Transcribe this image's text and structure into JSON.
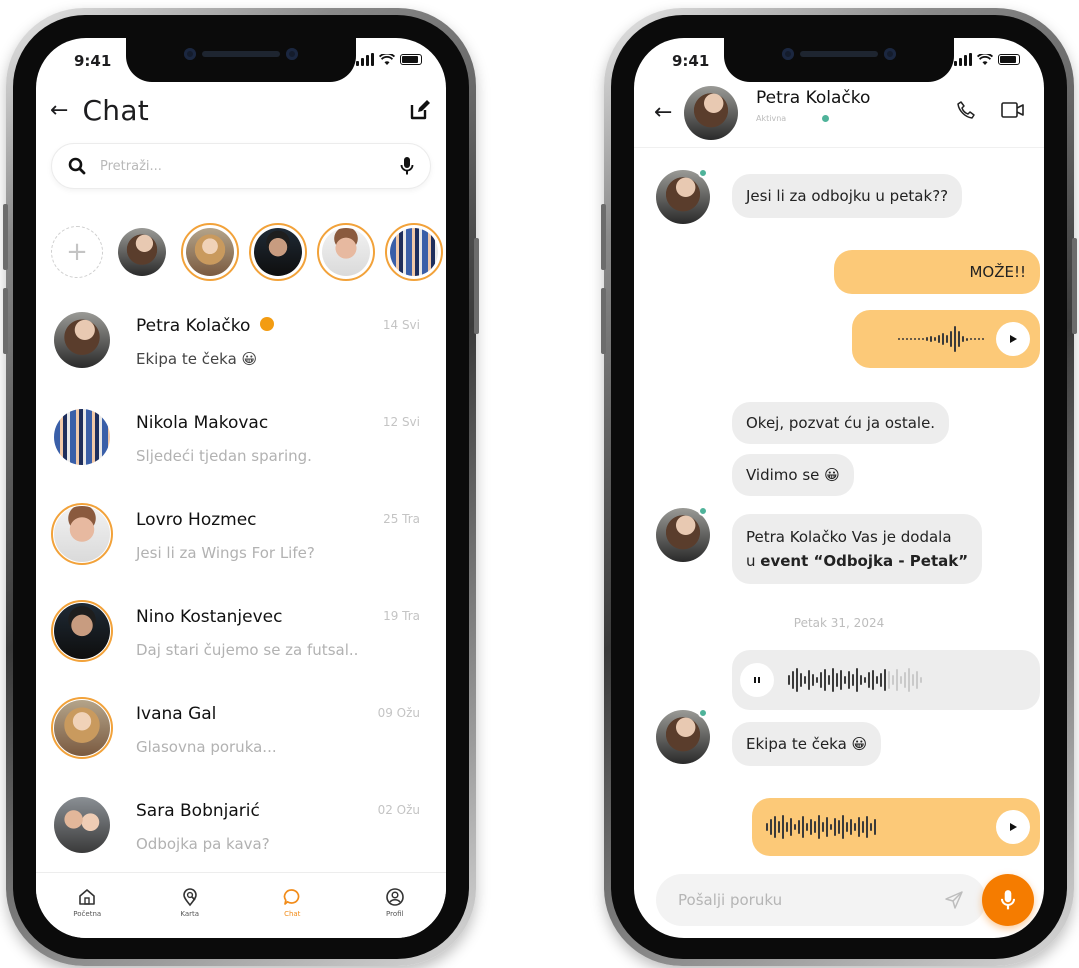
{
  "status_time": "9:41",
  "chat_screen": {
    "title": "Chat",
    "search_placeholder": "Pretraži...",
    "conversations": [
      {
        "name": "Petra Kolačko",
        "message": "Ekipa te čeka 😀",
        "date": "14 Svi",
        "unread": true
      },
      {
        "name": "Nikola Makovac",
        "message": "Sljedeći tjedan sparing.",
        "date": "12 Svi",
        "unread": false
      },
      {
        "name": "Lovro Hozmec",
        "message": "Jesi li za Wings For Life?",
        "date": "25 Tra",
        "unread": false
      },
      {
        "name": "Nino Kostanjevec",
        "message": "Daj stari čujemo se za futsal..",
        "date": "19 Tra",
        "unread": false
      },
      {
        "name": "Ivana Gal",
        "message": "Glasovna poruka...",
        "date": "09 Ožu",
        "unread": false
      },
      {
        "name": "Sara Bobnjarić",
        "message": "Odbojka pa kava?",
        "date": "02 Ožu",
        "unread": false
      }
    ],
    "tabs": [
      {
        "label": "Početna",
        "icon": "home-icon"
      },
      {
        "label": "Karta",
        "icon": "map-search-icon"
      },
      {
        "label": "Chat",
        "icon": "chat-bubble-icon",
        "active": true
      },
      {
        "label": "Profil",
        "icon": "profile-icon"
      }
    ]
  },
  "conversation_screen": {
    "contact_name": "Petra Kolačko",
    "contact_status": "Aktivna",
    "messages": {
      "m1": "Jesi li za odbojku u petak??",
      "m2": "MOŽE!!",
      "m4": "Okej, pozvat ću ja ostale.",
      "m5": "Vidimo se 😀",
      "m6_line1": "Petra Kolačko Vas je dodala",
      "m6_line2_prefix": "u ",
      "m6_line2_bold": "event “Odbojka - Petak”",
      "date_separator": "Petak 31, 2024",
      "m8": "Ekipa te čeka 😀"
    },
    "composer_placeholder": "Pošalji poruku"
  },
  "colors": {
    "accent": "#f57c00",
    "story_ring": "#f2a23a",
    "outgoing_bubble": "#fcc978",
    "incoming_bubble": "#ededed",
    "online_dot": "#4fb39a"
  }
}
